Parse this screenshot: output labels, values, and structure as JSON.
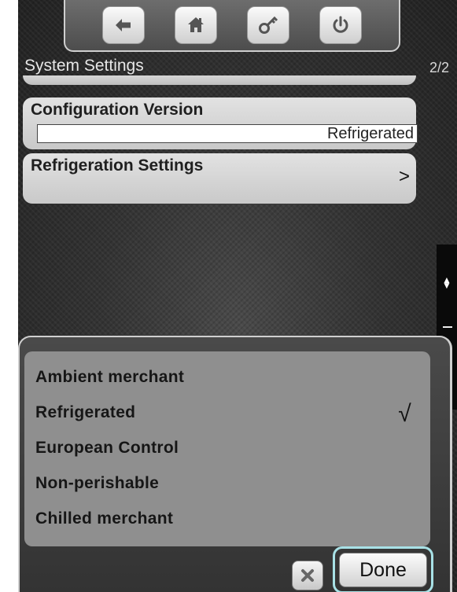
{
  "nav": {
    "buttons": [
      {
        "name": "back-arrow-icon"
      },
      {
        "name": "home-icon"
      },
      {
        "name": "key-icon"
      },
      {
        "name": "power-icon"
      }
    ]
  },
  "header": {
    "title": "System Settings",
    "page": "2/2"
  },
  "rows": {
    "config_label": "Configuration Version",
    "config_value": "Refrigerated",
    "refrig_label": "Refrigeration Settings",
    "refrig_chevron": ">"
  },
  "scrollbar": {
    "arrows": "▲▼"
  },
  "popup": {
    "options": [
      {
        "label": "Ambient merchant"
      },
      {
        "label": "Refrigerated",
        "selected": true
      },
      {
        "label": "European Control"
      },
      {
        "label": "Non-perishable"
      },
      {
        "label": "Chilled merchant"
      }
    ],
    "check_mark": "√",
    "done_label": "Done"
  }
}
